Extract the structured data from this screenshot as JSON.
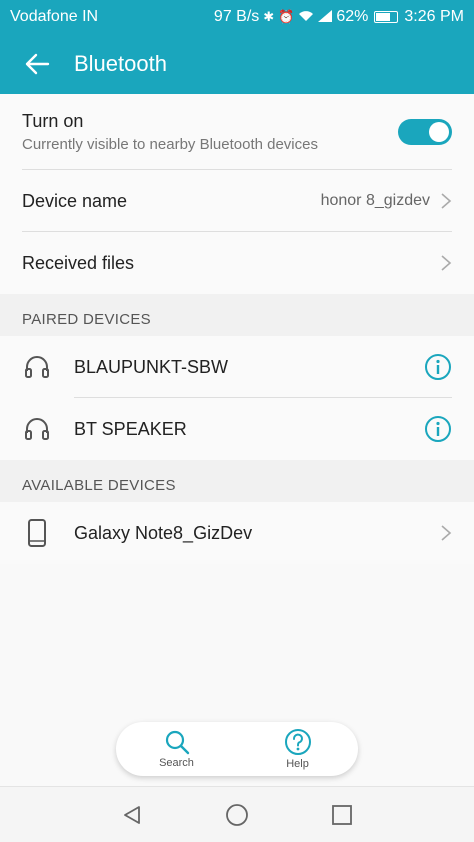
{
  "status_bar": {
    "carrier": "Vodafone IN",
    "speed": "97 B/s",
    "battery": "62%",
    "time": "3:26 PM"
  },
  "app_bar": {
    "title": "Bluetooth"
  },
  "turn_on": {
    "label": "Turn on",
    "subtitle": "Currently visible to nearby Bluetooth devices",
    "enabled": true
  },
  "device_name": {
    "label": "Device name",
    "value": "honor 8_gizdev"
  },
  "received_files": {
    "label": "Received files"
  },
  "paired": {
    "header": "PAIRED DEVICES",
    "devices": [
      {
        "name": "BLAUPUNKT-SBW",
        "icon": "headphones-icon"
      },
      {
        "name": "BT SPEAKER",
        "icon": "headphones-icon"
      }
    ]
  },
  "available": {
    "header": "AVAILABLE DEVICES",
    "devices": [
      {
        "name": "Galaxy Note8_GizDev",
        "icon": "phone-icon"
      }
    ]
  },
  "bottom_actions": {
    "search": "Search",
    "help": "Help"
  },
  "colors": {
    "accent": "#1aa6bd"
  }
}
